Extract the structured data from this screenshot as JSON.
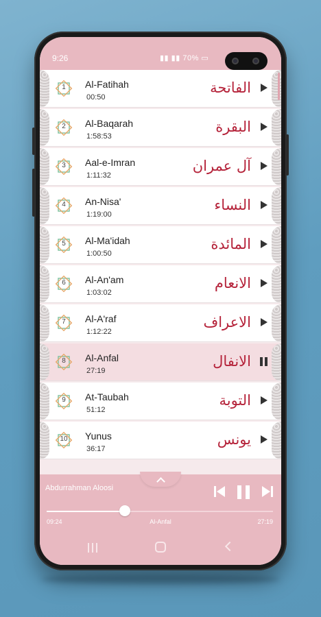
{
  "status": {
    "time": "9:26",
    "right": "70%"
  },
  "surahs": [
    {
      "num": "1",
      "en": "Al-Fatihah",
      "dur": "00:50",
      "ar": "الفاتحة"
    },
    {
      "num": "2",
      "en": "Al-Baqarah",
      "dur": "1:58:53",
      "ar": "البقرة"
    },
    {
      "num": "3",
      "en": "Aal-e-Imran",
      "dur": "1:11:32",
      "ar": "آل عمران"
    },
    {
      "num": "4",
      "en": "An-Nisa'",
      "dur": "1:19:00",
      "ar": "النساء"
    },
    {
      "num": "5",
      "en": "Al-Ma'idah",
      "dur": "1:00:50",
      "ar": "المائدة"
    },
    {
      "num": "6",
      "en": "Al-An'am",
      "dur": "1:03:02",
      "ar": "الانعام"
    },
    {
      "num": "7",
      "en": "Al-A'raf",
      "dur": "1:12:22",
      "ar": "الاعراف"
    },
    {
      "num": "8",
      "en": "Al-Anfal",
      "dur": "27:19",
      "ar": "الانفال"
    },
    {
      "num": "9",
      "en": "At-Taubah",
      "dur": "51:12",
      "ar": "التوبة"
    },
    {
      "num": "10",
      "en": "Yunus",
      "dur": "36:17",
      "ar": "يونس"
    }
  ],
  "active_index": 7,
  "player": {
    "reciter": "Abdurrahman Aloosi",
    "current_time": "09:24",
    "track_title": "Al-Anfal",
    "total_time": "27:19",
    "progress": 0.344
  },
  "colors": {
    "accent": "#e8b9c1",
    "arabic": "#b5233a",
    "active_row": "#f4dde1"
  }
}
